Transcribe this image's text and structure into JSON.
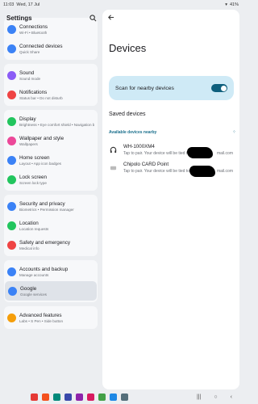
{
  "status": {
    "time": "11:03",
    "date": "Wed, 17 Jul",
    "battery": "41%"
  },
  "settings": {
    "title": "Settings",
    "groups": [
      {
        "items": [
          {
            "label": "Connections",
            "sub": "Wi-Fi • Bluetooth",
            "color": "#3b82f6",
            "icon": "wifi-icon"
          },
          {
            "label": "Connected devices",
            "sub": "Quick Share",
            "color": "#3b82f6",
            "icon": "devices-icon"
          }
        ]
      },
      {
        "items": [
          {
            "label": "Sound",
            "sub": "Sound mode",
            "color": "#8b5cf6",
            "icon": "speaker-icon"
          },
          {
            "label": "Notifications",
            "sub": "Status bar • Do not disturb",
            "color": "#ef4444",
            "icon": "bell-icon"
          }
        ]
      },
      {
        "items": [
          {
            "label": "Display",
            "sub": "Brightness • Eye comfort shield • Navigation bar",
            "color": "#22c55e",
            "icon": "sun-icon"
          },
          {
            "label": "Wallpaper and style",
            "sub": "Wallpapers",
            "color": "#ec4899",
            "icon": "wallpaper-icon"
          },
          {
            "label": "Home screen",
            "sub": "Layout • App icon badges",
            "color": "#3b82f6",
            "icon": "home-icon"
          },
          {
            "label": "Lock screen",
            "sub": "Screen lock type",
            "color": "#22c55e",
            "icon": "lock-icon"
          }
        ]
      },
      {
        "items": [
          {
            "label": "Security and privacy",
            "sub": "Biometrics • Permission manager",
            "color": "#3b82f6",
            "icon": "shield-icon"
          },
          {
            "label": "Location",
            "sub": "Location requests",
            "color": "#22c55e",
            "icon": "location-icon"
          },
          {
            "label": "Safety and emergency",
            "sub": "Medical info",
            "color": "#ef4444",
            "icon": "emergency-icon"
          }
        ]
      },
      {
        "items": [
          {
            "label": "Accounts and backup",
            "sub": "Manage accounts",
            "color": "#3b82f6",
            "icon": "sync-icon"
          },
          {
            "label": "Google",
            "sub": "Google services",
            "color": "#3b82f6",
            "icon": "google-icon"
          }
        ]
      },
      {
        "items": [
          {
            "label": "Advanced features",
            "sub": "Labs • S Pen • Side button",
            "color": "#f59e0b",
            "icon": "star-icon"
          }
        ]
      }
    ]
  },
  "devices": {
    "title": "Devices",
    "scan_label": "Scan for nearby devices",
    "scan_on": true,
    "saved_label": "Saved devices",
    "available_label": "Available devices nearby",
    "list": [
      {
        "name": "WH-1000XM4",
        "hint": "Tap to pair. Your device will be tied to",
        "hint_end": "mail.com",
        "icon": "headphones-icon"
      },
      {
        "name": "Chipolo CARD Point",
        "hint": "Tap to pair. Your device will be tied to",
        "hint_end": "mail.com",
        "icon": "tracker-icon"
      }
    ]
  }
}
